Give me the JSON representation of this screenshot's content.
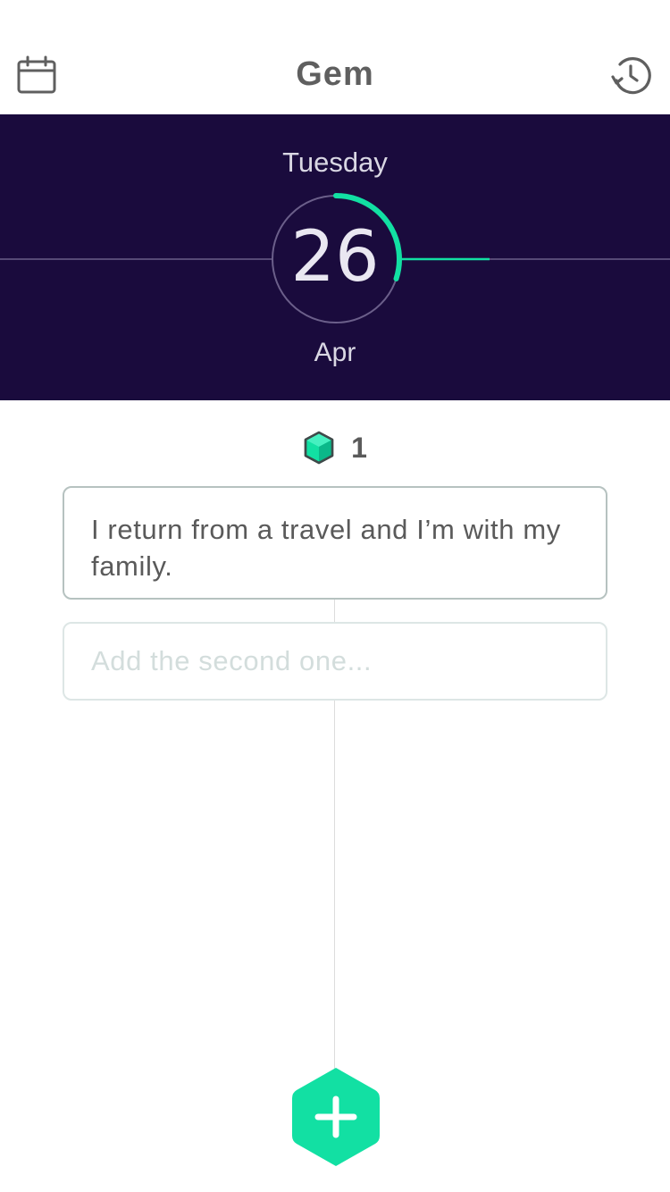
{
  "navbar": {
    "title": "Gem",
    "left_icon": "calendar-icon",
    "right_icon": "history-icon"
  },
  "date": {
    "weekday": "Tuesday",
    "day": "26",
    "month": "Apr",
    "progress_fraction": 0.3
  },
  "gems": {
    "icon": "gem-icon",
    "count": "1"
  },
  "entries": {
    "first_text": "I return from a travel and I’m with my family.",
    "second_placeholder": "Add the second one..."
  },
  "add_button": {
    "icon": "plus-icon"
  },
  "colors": {
    "header_bg": "#1a0b3d",
    "accent": "#12e0a3",
    "title_text": "#5f5f5f"
  }
}
